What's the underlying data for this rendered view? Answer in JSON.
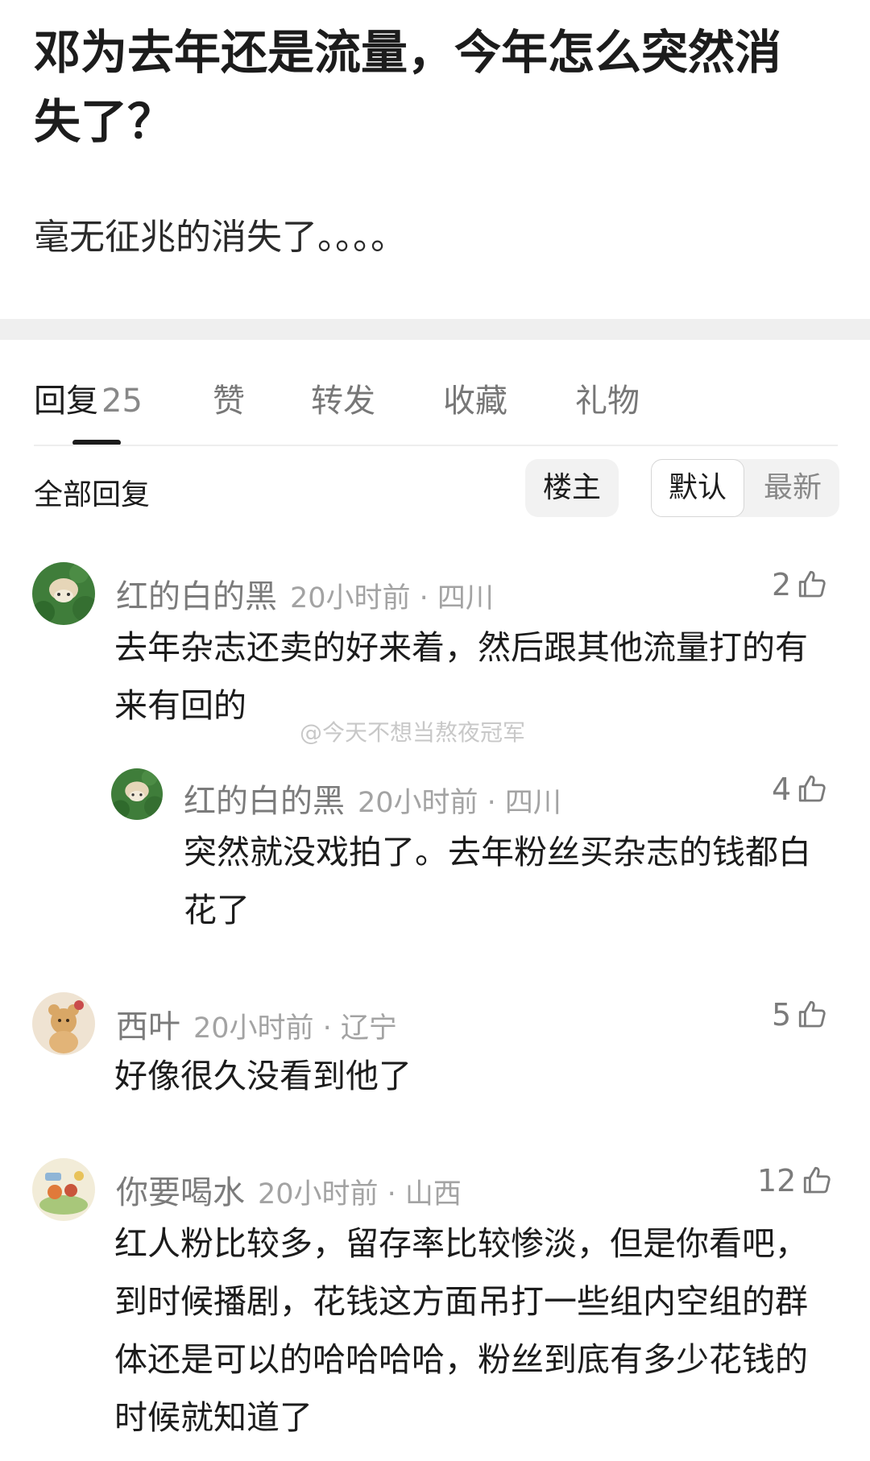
{
  "post": {
    "title": "邓为去年还是流量，今年怎么突然消失了？",
    "body": "毫无征兆的消失了。。。。"
  },
  "tabs": [
    {
      "label": "回复",
      "count": "25"
    },
    {
      "label": "赞"
    },
    {
      "label": "转发"
    },
    {
      "label": "收藏"
    },
    {
      "label": "礼物"
    }
  ],
  "filters": {
    "all_replies": "全部回复",
    "op": "楼主",
    "default": "默认",
    "latest": "最新"
  },
  "watermark": "@今天不想当熬夜冠军",
  "comments": [
    {
      "name": "红的白的黑",
      "time": "20小时前 · 四川",
      "likes": "2",
      "text": "去年杂志还卖的好来着，然后跟其他流量打的有来有回的"
    },
    {
      "name": "红的白的黑",
      "time": "20小时前 · 四川",
      "likes": "4",
      "text": "突然就没戏拍了。去年粉丝买杂志的钱都白花了"
    },
    {
      "name": "西叶",
      "time": "20小时前 · 辽宁",
      "likes": "5",
      "text": "好像很久没看到他了"
    },
    {
      "name": "你要喝水",
      "time": "20小时前 · 山西",
      "likes": "12",
      "text": "红人粉比较多，留存率比较惨淡，但是你看吧，到时候播剧，花钱这方面吊打一些组内空组的群体还是可以的哈哈哈哈，粉丝到底有多少花钱的时候就知道了"
    }
  ]
}
